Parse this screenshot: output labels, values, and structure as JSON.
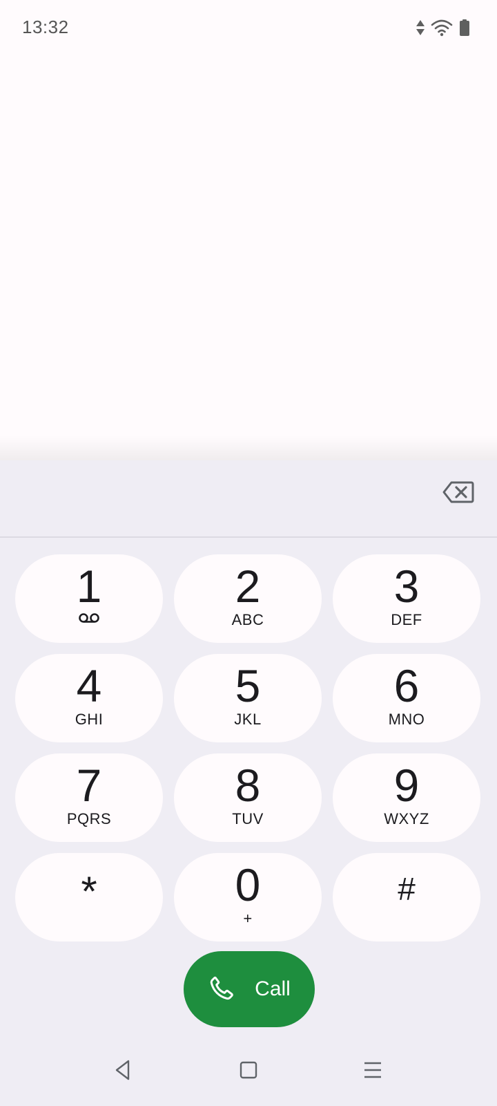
{
  "status_bar": {
    "time": "13:32",
    "icons": [
      "data-arrows-icon",
      "wifi-icon",
      "battery-icon"
    ]
  },
  "dialer": {
    "entered_digits": "",
    "keys": [
      {
        "digit": "1",
        "letters": "",
        "icon": "voicemail-icon"
      },
      {
        "digit": "2",
        "letters": "ABC"
      },
      {
        "digit": "3",
        "letters": "DEF"
      },
      {
        "digit": "4",
        "letters": "GHI"
      },
      {
        "digit": "5",
        "letters": "JKL"
      },
      {
        "digit": "6",
        "letters": "MNO"
      },
      {
        "digit": "7",
        "letters": "PQRS"
      },
      {
        "digit": "8",
        "letters": "TUV"
      },
      {
        "digit": "9",
        "letters": "WXYZ"
      },
      {
        "digit": "*",
        "letters": ""
      },
      {
        "digit": "0",
        "letters": "+"
      },
      {
        "digit": "#",
        "letters": ""
      }
    ],
    "call_label": "Call",
    "call_color": "#1e8e3e"
  },
  "nav_bar": {
    "buttons": [
      "back-icon",
      "home-icon",
      "recents-icon"
    ]
  },
  "colors": {
    "background": "#fffbfd",
    "sheet": "#efedf4",
    "key": "#fffbfd",
    "accent_green": "#1e8e3e"
  }
}
